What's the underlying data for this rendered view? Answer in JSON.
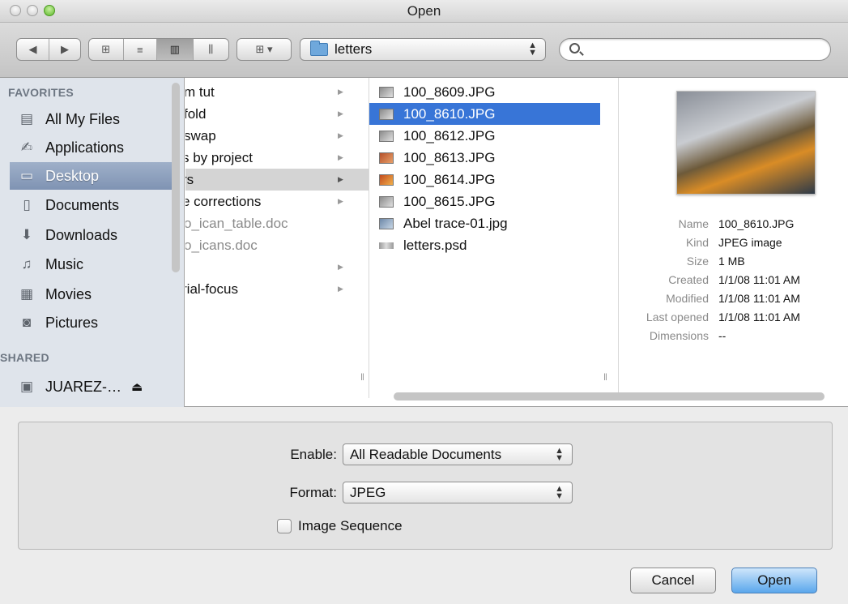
{
  "window": {
    "title": "Open"
  },
  "toolbar": {
    "path": "letters",
    "search_placeholder": ""
  },
  "sidebar": {
    "favorites_header": "FAVORITES",
    "favorites": [
      {
        "label": "All My Files",
        "icon": "all-files-icon"
      },
      {
        "label": "Applications",
        "icon": "applications-icon"
      },
      {
        "label": "Desktop",
        "icon": "desktop-icon",
        "selected": true
      },
      {
        "label": "Documents",
        "icon": "documents-icon"
      },
      {
        "label": "Downloads",
        "icon": "downloads-icon"
      },
      {
        "label": "Music",
        "icon": "music-icon"
      },
      {
        "label": "Movies",
        "icon": "movies-icon"
      },
      {
        "label": "Pictures",
        "icon": "pictures-icon"
      }
    ],
    "shared_header": "SHARED",
    "shared": [
      {
        "label": "JUAREZ-…",
        "icon": "computer-icon"
      }
    ]
  },
  "column1": [
    {
      "label": "m tut",
      "has_children": true
    },
    {
      "label": "fold",
      "has_children": true
    },
    {
      "label": "swap",
      "has_children": true
    },
    {
      "label": "s by project",
      "has_children": true
    },
    {
      "label": "rs",
      "has_children": true,
      "selected": true
    },
    {
      "label": "e corrections",
      "has_children": true
    },
    {
      "label": "o_ican_table.doc",
      "dim": true
    },
    {
      "label": "o_icans.doc",
      "dim": true
    },
    {
      "label": "",
      "has_children": true
    },
    {
      "label": "rial-focus",
      "has_children": true
    }
  ],
  "column2": [
    {
      "label": "100_8609.JPG"
    },
    {
      "label": "100_8610.JPG",
      "selected": true
    },
    {
      "label": "100_8612.JPG"
    },
    {
      "label": "100_8613.JPG"
    },
    {
      "label": "100_8614.JPG"
    },
    {
      "label": "100_8615.JPG"
    },
    {
      "label": "Abel trace-01.jpg"
    },
    {
      "label": "letters.psd"
    }
  ],
  "preview": {
    "fields": [
      {
        "key": "Name",
        "value": "100_8610.JPG"
      },
      {
        "key": "Kind",
        "value": "JPEG image"
      },
      {
        "key": "Size",
        "value": "1 MB"
      },
      {
        "key": "Created",
        "value": "1/1/08 11:01 AM"
      },
      {
        "key": "Modified",
        "value": "1/1/08 11:01 AM"
      },
      {
        "key": "Last opened",
        "value": "1/1/08 11:01 AM"
      },
      {
        "key": "Dimensions",
        "value": "--"
      }
    ]
  },
  "options": {
    "enable_label": "Enable:",
    "enable_value": "All Readable Documents",
    "format_label": "Format:",
    "format_value": "JPEG",
    "sequence_label": "Image Sequence"
  },
  "buttons": {
    "cancel": "Cancel",
    "open": "Open"
  }
}
